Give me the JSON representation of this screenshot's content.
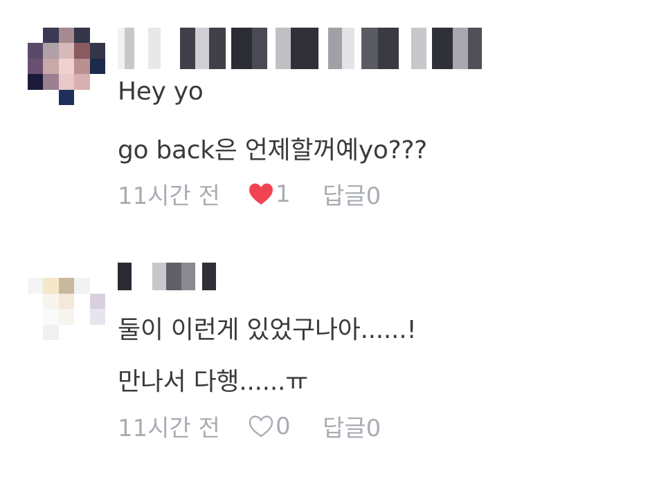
{
  "comments": [
    {
      "username_redacted": true,
      "line1": "Hey yo",
      "line2": "go back은 언제할꺼예yo???",
      "time": "11시간 전",
      "liked": true,
      "like_count": "1",
      "reply_label": "답글",
      "reply_count": "0",
      "heart_color": "#f04452"
    },
    {
      "username_redacted": true,
      "line1": "둘이 이런게 있었구나아......!",
      "line2": "만나서 다행......ㅠ",
      "time": "11시간 전",
      "liked": false,
      "like_count": "0",
      "reply_label": "답글",
      "reply_count": "0",
      "heart_color": "#a8acb3"
    }
  ]
}
